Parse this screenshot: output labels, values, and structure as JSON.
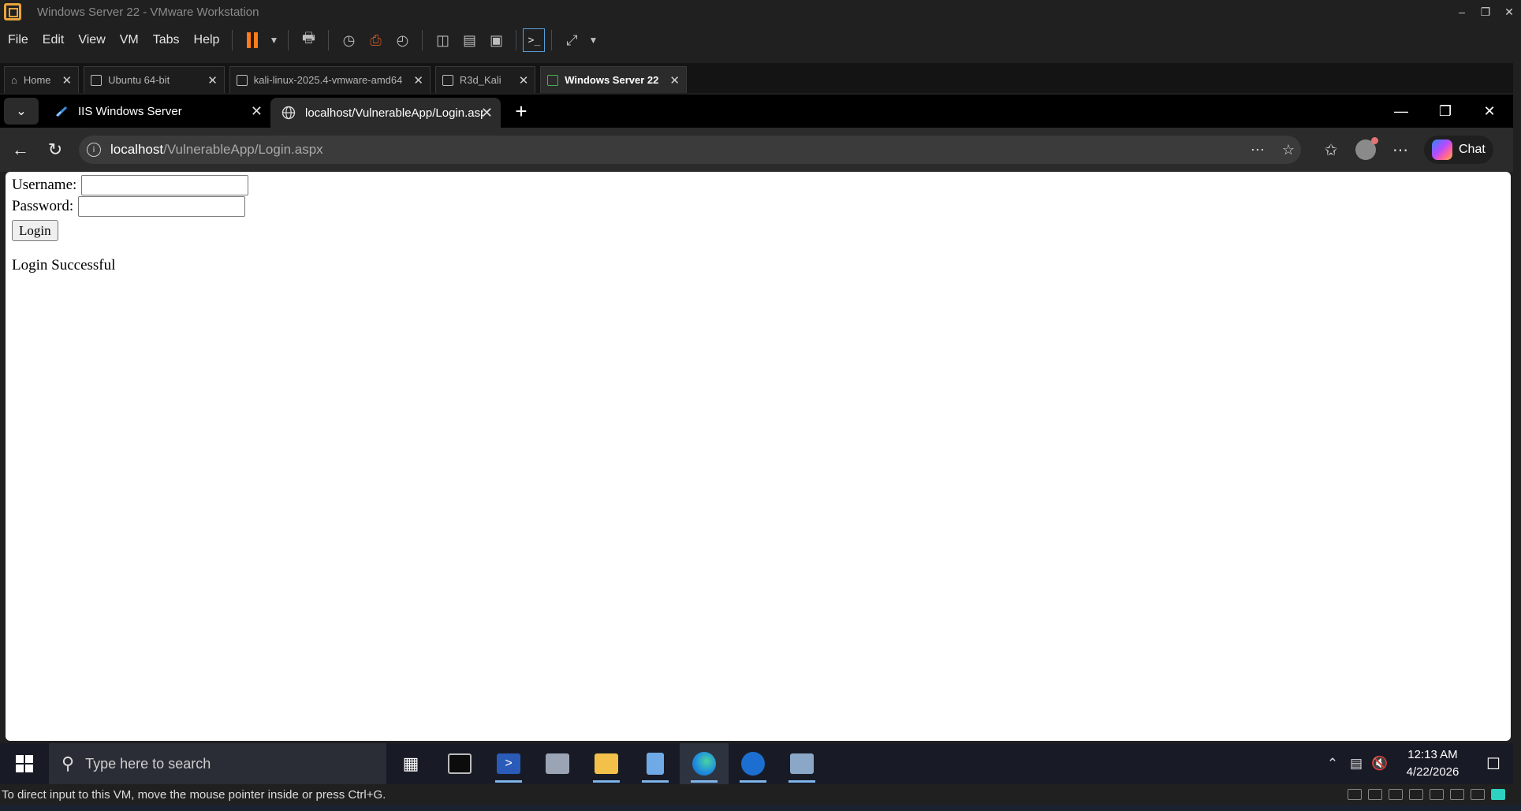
{
  "vmware": {
    "title": "Windows Server 22 - VMware Workstation",
    "menu": [
      "File",
      "Edit",
      "View",
      "VM",
      "Tabs",
      "Help"
    ],
    "tabs": [
      {
        "label": "Home",
        "active": false
      },
      {
        "label": "Ubuntu 64-bit",
        "active": false
      },
      {
        "label": "kali-linux-2025.4-vmware-amd64",
        "active": false
      },
      {
        "label": "R3d_Kali",
        "active": false
      },
      {
        "label": "Windows Server 22",
        "active": true
      }
    ],
    "status_text": "To direct input to this VM, move the mouse pointer inside or press Ctrl+G."
  },
  "browser": {
    "tabs": [
      {
        "label": "IIS Windows Server",
        "active": false
      },
      {
        "label": "localhost/VulnerableApp/Login.aspx",
        "active": true
      }
    ],
    "url_host": "localhost",
    "url_path": "/VulnerableApp/Login.aspx",
    "chat_label": "Chat"
  },
  "page": {
    "username_label": "Username:",
    "password_label": "Password:",
    "username_value": "",
    "password_value": "",
    "login_button": "Login",
    "message": "Login Successful"
  },
  "taskbar": {
    "search_placeholder": "Type here to search",
    "time": "12:13 AM",
    "date": "4/22/2026"
  },
  "colors": {
    "accent_orange": "#ff7a1a",
    "taskbar_bg": "#181b26",
    "page_bg": "#ffffff"
  }
}
